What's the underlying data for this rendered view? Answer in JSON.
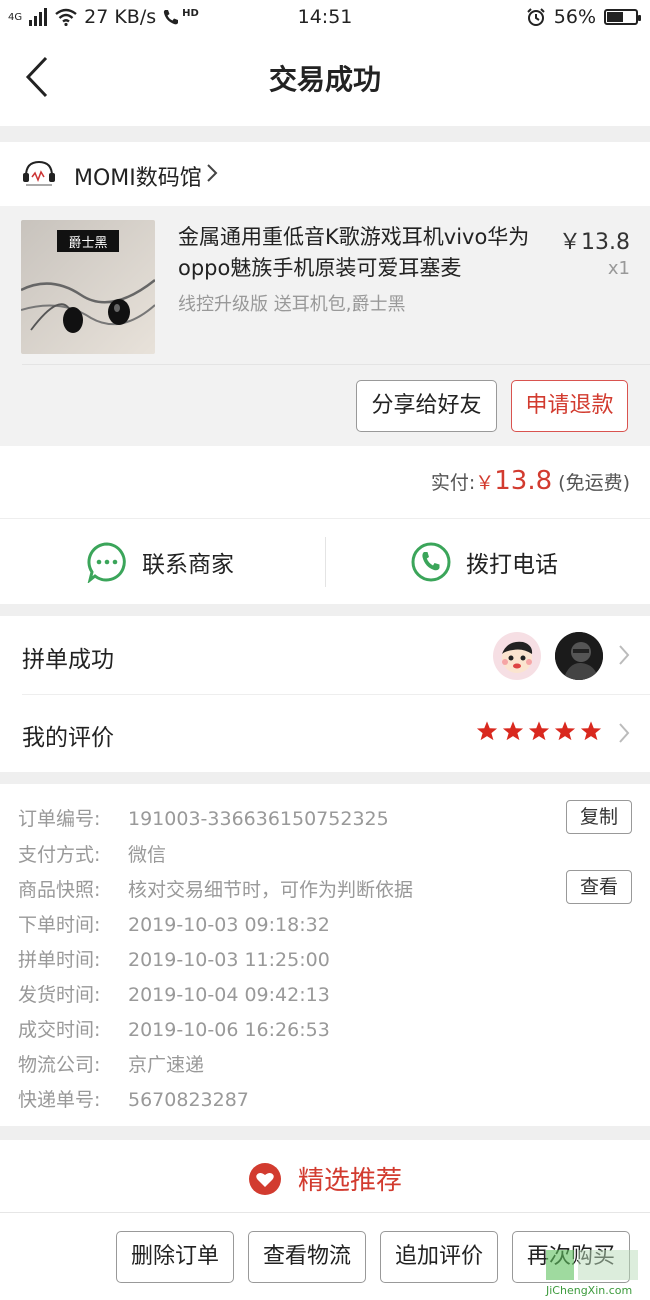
{
  "status_bar": {
    "network": "4G",
    "speed": "27 KB/s",
    "hd": "HD",
    "time": "14:51",
    "battery": "56%",
    "battery_level": 0.56
  },
  "header": {
    "title": "交易成功"
  },
  "shop": {
    "name": "MOMI数码馆"
  },
  "product": {
    "thumb_label": "爵士黑",
    "title": "金属通用重低音K歌游戏耳机vivo华为oppo魅族手机原装可爱耳塞麦",
    "spec": "线控升级版 送耳机包,爵士黑",
    "price": "￥13.8",
    "qty": "x1",
    "share_button": "分享给好友",
    "refund_button": "申请退款"
  },
  "payment": {
    "label": "实付:",
    "currency": "￥",
    "amount": "13.8",
    "shipping": "(免运费)"
  },
  "contact": {
    "merchant": "联系商家",
    "phone": "拨打电话"
  },
  "group": {
    "label": "拼单成功"
  },
  "review": {
    "label": "我的评价",
    "rating": 5
  },
  "order_info": {
    "rows": [
      {
        "key": "订单编号:",
        "value": "191003-336636150752325"
      },
      {
        "key": "支付方式:",
        "value": "微信"
      },
      {
        "key": "商品快照:",
        "value": "核对交易细节时，可作为判断依据"
      },
      {
        "key": "下单时间:",
        "value": "2019-10-03 09:18:32"
      },
      {
        "key": "拼单时间:",
        "value": "2019-10-03 11:25:00"
      },
      {
        "key": "发货时间:",
        "value": "2019-10-04 09:42:13"
      },
      {
        "key": "成交时间:",
        "value": "2019-10-06 16:26:53"
      },
      {
        "key": "物流公司:",
        "value": "京广速递"
      },
      {
        "key": "快递单号:",
        "value": "5670823287"
      }
    ],
    "copy_button": "复制",
    "view_button": "查看"
  },
  "recommend": {
    "label": "精选推荐"
  },
  "bottom_actions": {
    "delete": "删除订单",
    "logistics": "查看物流",
    "add_review": "追加评价",
    "buy_again": "再次购买"
  },
  "watermark": {
    "text": "JiChengXin.com"
  },
  "colors": {
    "accent_red": "#d23b2f",
    "green": "#3ba55a",
    "star_red": "#d9281e"
  }
}
